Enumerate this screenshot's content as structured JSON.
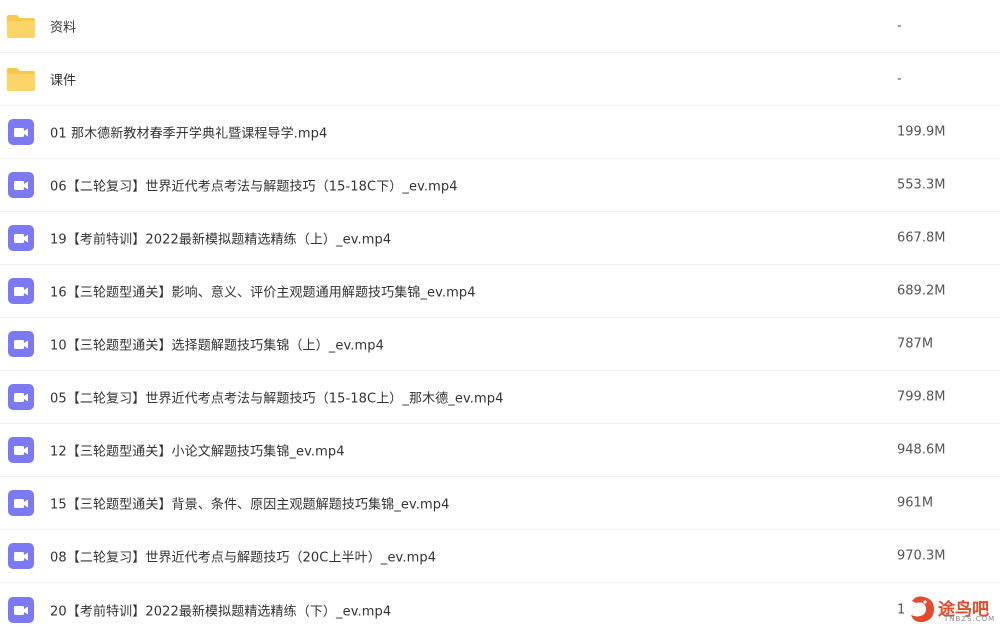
{
  "files": [
    {
      "icon": "folder-icon",
      "name": "资料",
      "size": "-"
    },
    {
      "icon": "folder-icon",
      "name": "课件",
      "size": "-"
    },
    {
      "icon": "video-file-icon",
      "name": "01 那木德新教材春季开学典礼暨课程导学.mp4",
      "size": "199.9M"
    },
    {
      "icon": "video-file-icon",
      "name": "06【二轮复习】世界近代考点考法与解题技巧（15-18C下）_ev.mp4",
      "size": "553.3M"
    },
    {
      "icon": "video-file-icon",
      "name": "19【考前特训】2022最新模拟题精选精练（上）_ev.mp4",
      "size": "667.8M"
    },
    {
      "icon": "video-file-icon",
      "name": "16【三轮题型通关】影响、意义、评价主观题通用解题技巧集锦_ev.mp4",
      "size": "689.2M"
    },
    {
      "icon": "video-file-icon",
      "name": "10【三轮题型通关】选择题解题技巧集锦（上）_ev.mp4",
      "size": "787M"
    },
    {
      "icon": "video-file-icon",
      "name": "05【二轮复习】世界近代考点考法与解题技巧（15-18C上）_那木德_ev.mp4",
      "size": "799.8M"
    },
    {
      "icon": "video-file-icon",
      "name": "12【三轮题型通关】小论文解题技巧集锦_ev.mp4",
      "size": "948.6M"
    },
    {
      "icon": "video-file-icon",
      "name": "15【三轮题型通关】背景、条件、原因主观题解题技巧集锦_ev.mp4",
      "size": "961M"
    },
    {
      "icon": "video-file-icon",
      "name": "08【二轮复习】世界近代考点与解题技巧（20C上半叶）_ev.mp4",
      "size": "970.3M"
    },
    {
      "icon": "video-file-icon",
      "name": "20【考前特训】2022最新模拟题精选精练（下）_ev.mp4",
      "size": "1"
    }
  ],
  "watermark": {
    "text": "途鸟吧",
    "sub": "TNBZS.COM"
  },
  "colors": {
    "folder": "#f9c94e",
    "video": "#7c7af2",
    "divider": "#eef0f4",
    "watermark": "#e14b2f"
  }
}
